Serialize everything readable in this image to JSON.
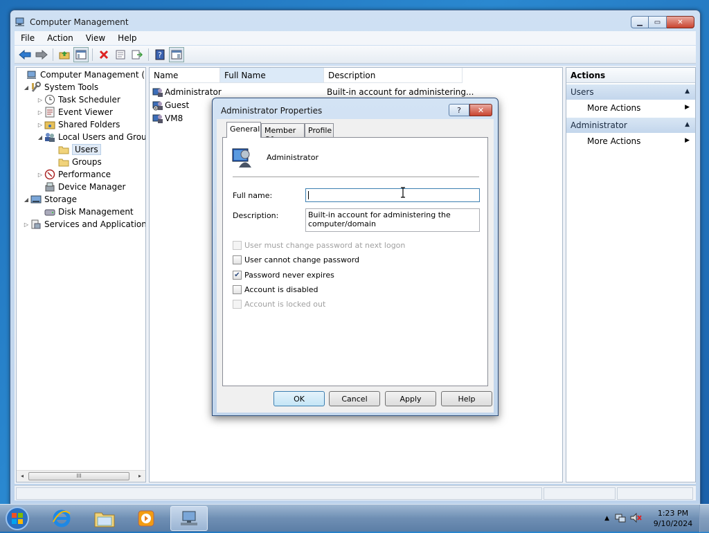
{
  "window": {
    "title": "Computer Management"
  },
  "menu": [
    "File",
    "Action",
    "View",
    "Help"
  ],
  "toolbar": {
    "icons": [
      "back-arrow-icon",
      "forward-arrow-icon",
      "up-folder-icon",
      "show-hide-tree-icon",
      "delete-icon",
      "properties-icon",
      "export-list-icon",
      "help-icon",
      "show-hide-action-pane-icon"
    ]
  },
  "tree": {
    "items": [
      {
        "label": "Computer Management (Local",
        "icon": "computer-management-icon"
      },
      {
        "label": "System Tools",
        "icon": "system-tools-icon"
      },
      {
        "label": "Task Scheduler",
        "icon": "clock-icon"
      },
      {
        "label": "Event Viewer",
        "icon": "event-viewer-icon"
      },
      {
        "label": "Shared Folders",
        "icon": "shared-folder-icon"
      },
      {
        "label": "Local Users and Groups",
        "icon": "users-icon"
      },
      {
        "label": "Users",
        "icon": "folder-icon"
      },
      {
        "label": "Groups",
        "icon": "folder-icon"
      },
      {
        "label": "Performance",
        "icon": "performance-icon"
      },
      {
        "label": "Device Manager",
        "icon": "device-manager-icon"
      },
      {
        "label": "Storage",
        "icon": "storage-icon"
      },
      {
        "label": "Disk Management",
        "icon": "disk-icon"
      },
      {
        "label": "Services and Applications",
        "icon": "services-icon"
      }
    ],
    "scroll_thumb": "III"
  },
  "list": {
    "columns": [
      "Name",
      "Full Name",
      "Description"
    ],
    "rows": [
      {
        "name": "Administrator",
        "full_name": "",
        "description": "Built-in account for administering..."
      },
      {
        "name": "Guest",
        "full_name": "",
        "description": ""
      },
      {
        "name": "VM8",
        "full_name": "",
        "description": ""
      }
    ]
  },
  "actions": {
    "title": "Actions",
    "groups": [
      {
        "label": "Users",
        "item": "More Actions"
      },
      {
        "label": "Administrator",
        "item": "More Actions"
      }
    ]
  },
  "dialog": {
    "title": "Administrator Properties",
    "help_glyph": "?",
    "close_glyph": "✕",
    "tabs": [
      "General",
      "Member Of",
      "Profile"
    ],
    "active_tab": "General",
    "user_name": "Administrator",
    "full_name_label": "Full name:",
    "full_name_value": "",
    "description_label": "Description:",
    "description_value": "Built-in account for administering the computer/domain",
    "checkboxes": [
      {
        "label": "User must change password at next logon",
        "checked": false,
        "enabled": false
      },
      {
        "label": "User cannot change password",
        "checked": false,
        "enabled": true
      },
      {
        "label": "Password never expires",
        "checked": true,
        "enabled": true
      },
      {
        "label": "Account is disabled",
        "checked": false,
        "enabled": true
      },
      {
        "label": "Account is locked out",
        "checked": false,
        "enabled": false
      }
    ],
    "buttons": {
      "ok": "OK",
      "cancel": "Cancel",
      "apply": "Apply",
      "help": "Help"
    }
  },
  "taskbar": {
    "apps": [
      "internet-explorer-icon",
      "windows-explorer-icon",
      "media-player-icon",
      "computer-management-icon"
    ],
    "time": "1:23 PM",
    "date": "9/10/2024"
  },
  "colors": {
    "accent": "#3c7fb1",
    "selection": "#dfe9f5",
    "desktop": "#1f6fb8"
  }
}
